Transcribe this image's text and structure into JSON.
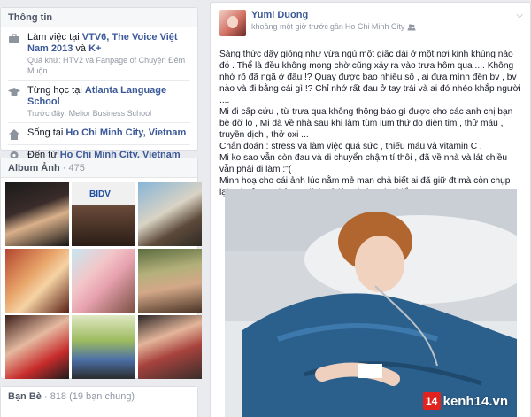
{
  "info": {
    "title": "Thông tin",
    "work": {
      "prefix": "Làm việc tại ",
      "org": "VTV6, The Voice Việt Nam 2013",
      "and": " và ",
      "org2": "K+",
      "sub": "Quá khứ: HTV2 và Fanpage of Chuyện Đêm Muộn"
    },
    "study": {
      "prefix": "Từng học tại ",
      "school": "Atlanta Language School",
      "sub": "Trước đây: Melior Business School"
    },
    "lives": {
      "prefix": "Sống tại ",
      "city": "Ho Chi Minh City, Vietnam"
    },
    "from": {
      "prefix": "Đến từ ",
      "city": "Ho Chi Minh City, Vietnam"
    }
  },
  "album": {
    "title": "Album Ảnh",
    "count": "· 475"
  },
  "friends": {
    "title": "Bạn Bè",
    "count": "· 818 (19 bạn chung)"
  },
  "post": {
    "author": "Yumi Duong",
    "meta_time": "khoảng một giờ trước",
    "meta_near": "gần",
    "meta_place": "Ho Chi Minh City",
    "paragraphs": [
      "Sáng thức dậy giống như vừa ngủ một giấc dài ở một nơi kinh khủng nào đó . Thể là đều không mong chờ cũng xảy ra vào trưa hôm qua .... Không nhớ rõ đã ngã ở đâu !? Quay được bao nhiêu số , ai đưa mình đến bv , bv nào và đi bằng cái gì !? Chỉ nhớ rất đau ở tay trái và ai đó nhéo khắp người ....",
      "Mi đi cấp cứu , từ trưa qua không thông báo gì được cho các anh chị bạn bè đỡ lo , Mi đã về nhà sau khi làm tùm lum thứ đo điện tim , thử máu , truyền dịch , thở oxi ...",
      "Chẩn đoán : stress và làm việc quá sức , thiếu máu và vitamin C .",
      "Mi ko sao vẫn còn đau và di chuyển chậm tí thôi , đã về nhà và lát chiều vẫn phải đi làm :\"(",
      "Minh hoạ cho cái ảnh lúc nằm mẻ man chả biết ai đã giữ đt mà còn chụp lại máu ở tay chảy ra dính cả lên giường ko hiểu =.="
    ],
    "watermark_badge": "14",
    "watermark_text": "kenh14.vn"
  },
  "colors": {
    "link": "#3b5998",
    "muted": "#9197a3",
    "accent_red": "#e1231f"
  }
}
